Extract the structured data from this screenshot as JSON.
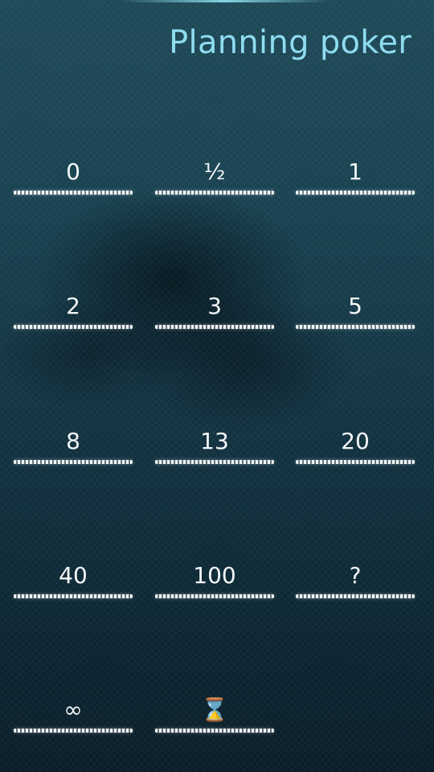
{
  "header": {
    "title": "Planning poker"
  },
  "cards": [
    {
      "label": "0"
    },
    {
      "label": "½"
    },
    {
      "label": "1"
    },
    {
      "label": "2"
    },
    {
      "label": "3"
    },
    {
      "label": "5"
    },
    {
      "label": "8"
    },
    {
      "label": "13"
    },
    {
      "label": "20"
    },
    {
      "label": "40"
    },
    {
      "label": "100"
    },
    {
      "label": "?"
    },
    {
      "label": "∞"
    },
    {
      "label": "⌛"
    }
  ]
}
